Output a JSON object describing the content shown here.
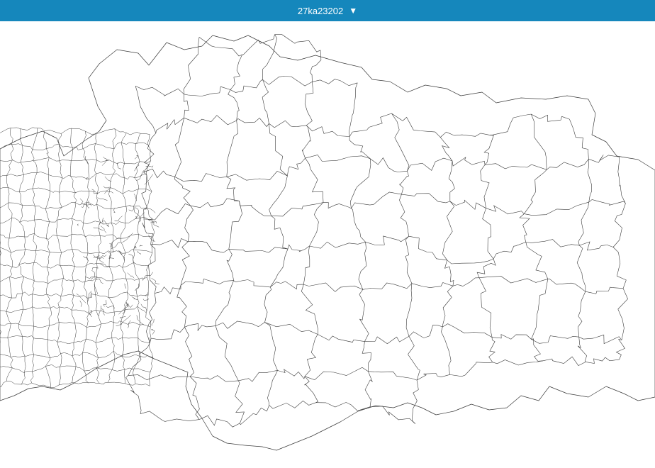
{
  "header": {
    "selector_label": "27ka23202",
    "caret_icon": "caret-down-icon",
    "bar_color": "#1587bc"
  },
  "map": {
    "feature_stroke": "#3a3a3a",
    "feature_fill": "#ffffff",
    "background": "#ffffff"
  }
}
